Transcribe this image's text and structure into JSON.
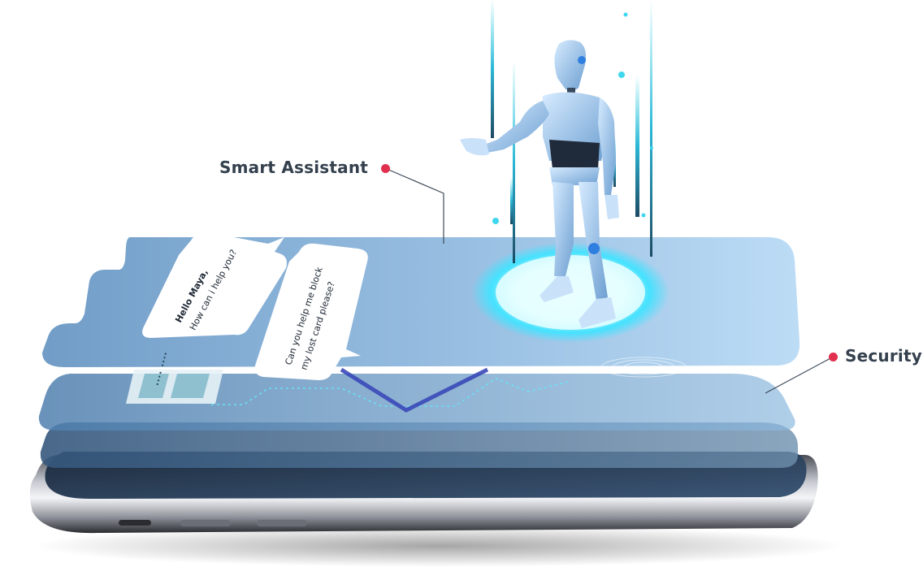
{
  "callouts": {
    "smart_assistant": {
      "label": "Smart Assistant"
    },
    "security": {
      "label": "Security"
    }
  },
  "chat": {
    "greeting_line1": "Hello Maya,",
    "greeting_line2": "How can i help you?",
    "request_line1": "Can you help me block",
    "request_line2": "my lost card please?"
  },
  "card": {
    "masked_digits": "•••• ••••"
  },
  "colors": {
    "accent_dot": "#e0304e",
    "label_text": "#34404d",
    "layer_blue": "#6f9fcc",
    "glow": "#3fe3ff",
    "robot_body": "#a9cdee"
  },
  "icons": [
    "robot-icon",
    "fingerprint-icon",
    "speech-bubble-icon",
    "credit-card-icon",
    "smartphone-icon"
  ]
}
